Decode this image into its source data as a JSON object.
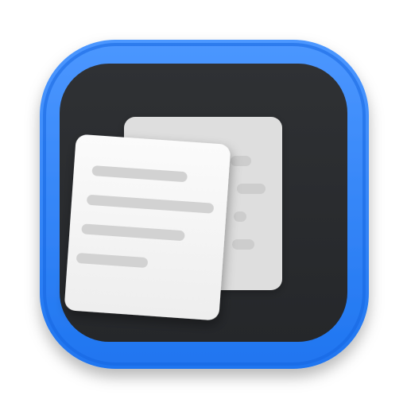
{
  "app_icon": {
    "icon_name": "document-pages-icon",
    "colors": {
      "page_background": "#ffffff",
      "frame_blue": "#1f75f0",
      "frame_blue_highlight": "#4c97ff",
      "inner_dark": "#2a2c2f",
      "back_page": "#dedede",
      "front_page": "#f5f5f5",
      "text_line": "#d2d2d2"
    }
  }
}
